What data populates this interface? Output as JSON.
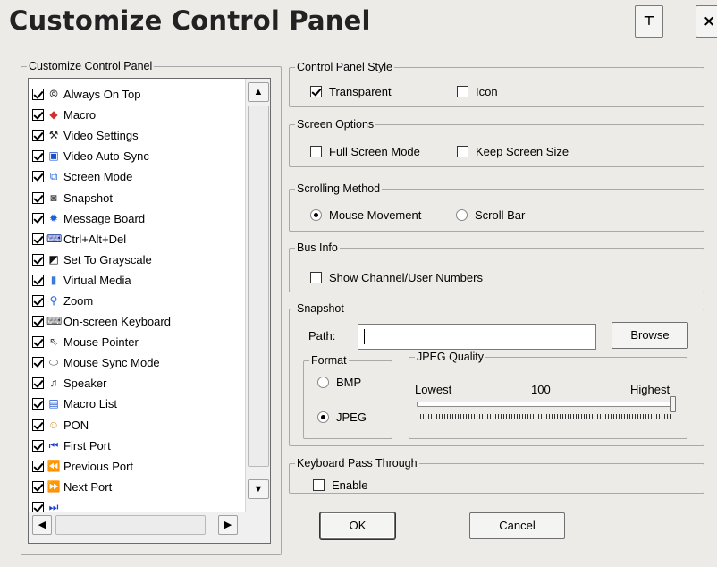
{
  "window": {
    "title": "Customize Control Panel",
    "pin_glyph": "⊤",
    "close_glyph": "×"
  },
  "list_group": {
    "legend": "Customize Control Panel",
    "items": [
      {
        "label": "Always On Top",
        "icon": "pin-icon",
        "glyph": "⦾",
        "color": "#333333",
        "checked": true
      },
      {
        "label": "Macro",
        "icon": "macro-icon",
        "glyph": "◆",
        "color": "#d03030",
        "checked": true
      },
      {
        "label": "Video Settings",
        "icon": "hammer-icon",
        "glyph": "⚒",
        "color": "#222222",
        "checked": true
      },
      {
        "label": "Video Auto-Sync",
        "icon": "monitor-icon",
        "glyph": "▣",
        "color": "#1a4fcf",
        "checked": true
      },
      {
        "label": "Screen Mode",
        "icon": "screen-mode-icon",
        "glyph": "⧉",
        "color": "#2a6fd8",
        "checked": true
      },
      {
        "label": "Snapshot",
        "icon": "camera-icon",
        "glyph": "◙",
        "color": "#555555",
        "checked": true
      },
      {
        "label": "Message Board",
        "icon": "message-board-icon",
        "glyph": "✹",
        "color": "#1a5fd8",
        "checked": true
      },
      {
        "label": "Ctrl+Alt+Del",
        "icon": "ctrl-alt-del-icon",
        "glyph": "⌨",
        "color": "#0a2a9a",
        "checked": true
      },
      {
        "label": "Set To Grayscale",
        "icon": "grayscale-icon",
        "glyph": "◩",
        "color": "#111111",
        "checked": true
      },
      {
        "label": "Virtual Media",
        "icon": "virtual-media-icon",
        "glyph": "▮",
        "color": "#3a7ad8",
        "checked": true
      },
      {
        "label": "Zoom",
        "icon": "zoom-icon",
        "glyph": "⚲",
        "color": "#1a5fd8",
        "checked": true
      },
      {
        "label": "On-screen Keyboard",
        "icon": "keyboard-icon",
        "glyph": "⌨",
        "color": "#444444",
        "checked": true
      },
      {
        "label": "Mouse Pointer",
        "icon": "mouse-pointer-icon",
        "glyph": "⇖",
        "color": "#444444",
        "checked": true
      },
      {
        "label": "Mouse Sync Mode",
        "icon": "mouse-icon",
        "glyph": "⬭",
        "color": "#444444",
        "checked": true
      },
      {
        "label": "Speaker",
        "icon": "speaker-icon",
        "glyph": "♫",
        "color": "#333333",
        "checked": true
      },
      {
        "label": "Macro List",
        "icon": "macro-list-icon",
        "glyph": "▤",
        "color": "#1a4fcf",
        "checked": true
      },
      {
        "label": "PON",
        "icon": "pon-icon",
        "glyph": "☺",
        "color": "#d08a20",
        "checked": true
      },
      {
        "label": "First Port",
        "icon": "first-port-icon",
        "glyph": "⏮",
        "color": "#1a3fcf",
        "checked": true
      },
      {
        "label": "Previous Port",
        "icon": "previous-port-icon",
        "glyph": "⏪",
        "color": "#1a3fcf",
        "checked": true
      },
      {
        "label": "Next Port",
        "icon": "next-port-icon",
        "glyph": "⏩",
        "color": "#1a3fcf",
        "checked": true
      },
      {
        "label": "",
        "icon": "last-port-icon",
        "glyph": "⏭",
        "color": "#1a3fcf",
        "checked": true
      }
    ]
  },
  "style_group": {
    "legend": "Control Panel Style",
    "transparent": {
      "label": "Transparent",
      "checked": true
    },
    "icon": {
      "label": "Icon",
      "checked": false
    }
  },
  "screen_group": {
    "legend": "Screen Options",
    "full_screen": {
      "label": "Full Screen Mode",
      "checked": false
    },
    "keep_size": {
      "label": "Keep Screen Size",
      "checked": false
    }
  },
  "scroll_group": {
    "legend": "Scrolling Method",
    "mouse_movement": {
      "label": "Mouse Movement",
      "selected": true
    },
    "scroll_bar": {
      "label": "Scroll Bar",
      "selected": false
    }
  },
  "bus_group": {
    "legend": "Bus Info",
    "show_numbers": {
      "label": "Show Channel/User Numbers",
      "checked": false
    }
  },
  "snapshot_group": {
    "legend": "Snapshot",
    "path_label": "Path:",
    "path_value": "",
    "browse_label": "Browse",
    "format": {
      "legend": "Format",
      "bmp": {
        "label": "BMP",
        "selected": false
      },
      "jpeg": {
        "label": "JPEG",
        "selected": true
      }
    },
    "quality": {
      "legend": "JPEG Quality",
      "low_label": "Lowest",
      "value": "100",
      "high_label": "Highest",
      "level": 1.0
    }
  },
  "keyboard_group": {
    "legend": "Keyboard Pass Through",
    "enable": {
      "label": "Enable",
      "checked": false
    }
  },
  "buttons": {
    "ok": "OK",
    "cancel": "Cancel"
  }
}
